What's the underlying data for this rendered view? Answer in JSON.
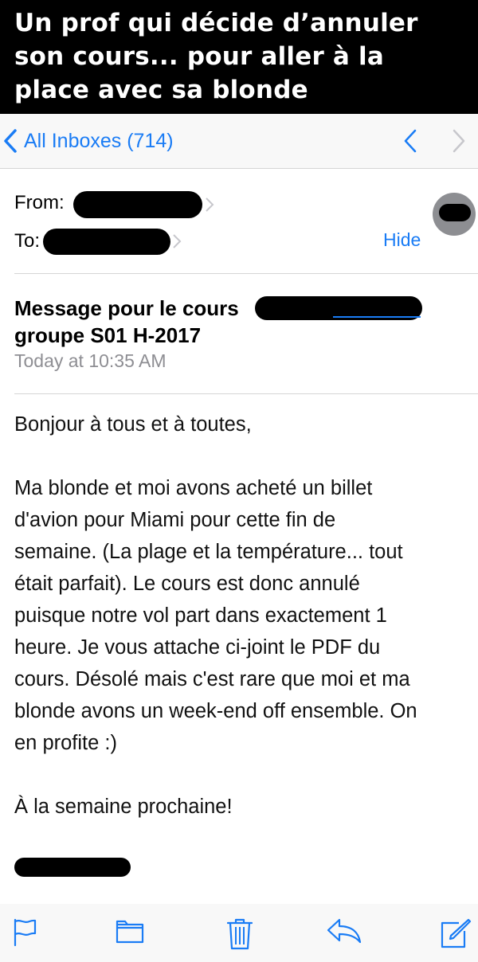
{
  "caption": {
    "text": "Un prof qui décide d’annuler\nson cours... pour aller à la\nplace avec sa blonde"
  },
  "nav": {
    "back_label": "All Inboxes (714)"
  },
  "header": {
    "from_label": "From:",
    "to_label": "To:",
    "hide_label": "Hide"
  },
  "message": {
    "subject_line1": "Message pour le cours",
    "subject_line2": "groupe S01 H-2017",
    "date": "Today at 10:35 AM",
    "greeting": "Bonjour à tous et à toutes,",
    "body": "Ma blonde et moi avons acheté un billet\nd'avion pour Miami pour cette fin de\nsemaine. (La plage et la température... tout\nétait parfait). Le cours est donc annulé\npuisque notre vol part dans exactement 1\nheure. Je vous attache ci-joint le PDF du\ncours. Désolé mais c'est rare que moi et ma\nblonde avons un week-end off ensemble. On\nen profite :)",
    "closing": "À la semaine prochaine!"
  },
  "colors": {
    "accent": "#1a7cf5",
    "muted": "#8e8e93",
    "caption_bg": "#000000"
  },
  "toolbar": {
    "icons": [
      "flag-icon",
      "folder-icon",
      "trash-icon",
      "reply-icon",
      "compose-icon"
    ]
  }
}
